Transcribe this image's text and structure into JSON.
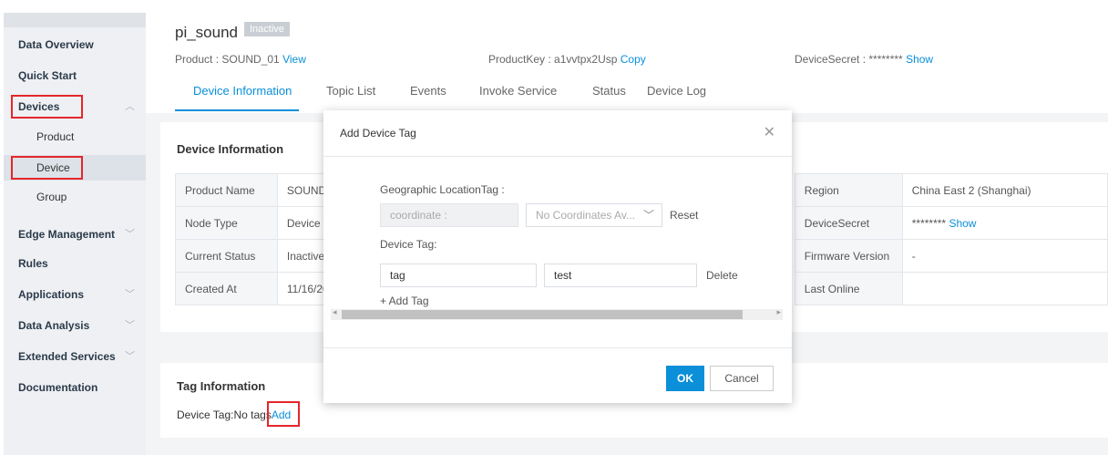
{
  "sidebar": {
    "items": [
      {
        "label": "Data Overview"
      },
      {
        "label": "Quick Start"
      },
      {
        "label": "Devices"
      },
      {
        "label": "Product"
      },
      {
        "label": "Device"
      },
      {
        "label": "Group"
      },
      {
        "label": "Edge Management"
      },
      {
        "label": "Rules"
      },
      {
        "label": "Applications"
      },
      {
        "label": "Data Analysis"
      },
      {
        "label": "Extended Services"
      },
      {
        "label": "Documentation"
      }
    ]
  },
  "header": {
    "device_name": "pi_sound",
    "status_badge": "Inactive",
    "product_label": "Product : SOUND_01",
    "product_link": "View",
    "productkey_label": "ProductKey : a1vvtpx2Usp",
    "productkey_link": "Copy",
    "secret_label": "DeviceSecret : ********",
    "secret_link": "Show"
  },
  "tabs": [
    {
      "label": "Device Information"
    },
    {
      "label": "Topic List"
    },
    {
      "label": "Events"
    },
    {
      "label": "Invoke Service"
    },
    {
      "label": "Status"
    },
    {
      "label": "Device Log"
    }
  ],
  "device_info": {
    "title": "Device Information",
    "rows": [
      {
        "l1": "Product Name",
        "v1": "SOUND",
        "l3": "Region",
        "v3": "China East 2 (Shanghai)"
      },
      {
        "l1": "Node Type",
        "v1": "Device",
        "l3": "DeviceSecret",
        "v3": "********",
        "v3_link": "Show"
      },
      {
        "l1": "Current Status",
        "v1": "Inactive",
        "l3": "Firmware Version",
        "v3": "-"
      },
      {
        "l1": "Created At",
        "v1": "11/16/20",
        "l3": "Last Online",
        "v3": ""
      }
    ]
  },
  "tag_info": {
    "title": "Tag Information",
    "text": "Device Tag:No tags",
    "add_link": "Add"
  },
  "modal": {
    "title": "Add Device Tag",
    "geo_label": "Geographic LocationTag :",
    "coord_placeholder": "coordinate :",
    "coord_select": "No Coordinates Av...",
    "reset_link": "Reset",
    "device_tag_label": "Device Tag:",
    "tag_key": "tag",
    "tag_value": "test",
    "delete_link": "Delete",
    "add_tag_link": "+ Add Tag",
    "ok_label": "OK",
    "cancel_label": "Cancel"
  },
  "colors": {
    "accent": "#0a8fd8",
    "highlight_box": "#e5262a",
    "sidebar_bg": "#eef0f3"
  }
}
